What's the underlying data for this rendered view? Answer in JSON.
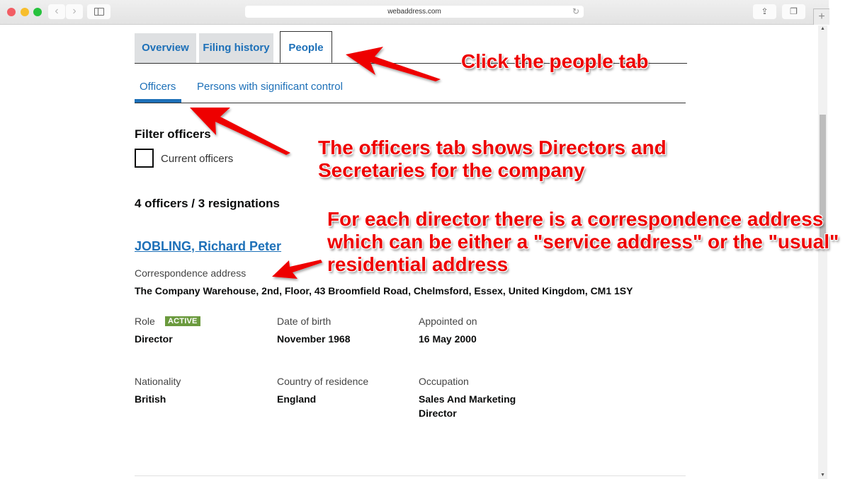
{
  "browser": {
    "url": "webaddress.com",
    "icons": {
      "close": "close-window-icon",
      "minimize": "minimize-window-icon",
      "maximize": "maximize-window-icon",
      "back": "chevron-left-icon",
      "forward": "chevron-right-icon",
      "sidebar": "sidebar-icon",
      "reload": "reload-icon",
      "share": "share-icon",
      "tabs": "tabs-overview-icon",
      "new_tab": "plus-icon"
    },
    "back_glyph": "‹",
    "forward_glyph": "›",
    "reload_glyph": "↻",
    "share_glyph": "⇪",
    "tabs_glyph": "❐",
    "new_tab_glyph": "+",
    "scroll_up_glyph": "▲",
    "scroll_down_glyph": "▼"
  },
  "tabs": {
    "main": [
      {
        "label": "Overview",
        "active": false
      },
      {
        "label": "Filing history",
        "active": false
      },
      {
        "label": "People",
        "active": true
      }
    ],
    "sub": [
      {
        "label": "Officers",
        "active": true
      },
      {
        "label": "Persons with significant control",
        "active": false
      }
    ]
  },
  "filter": {
    "heading": "Filter officers",
    "checkbox_label": "Current officers",
    "checked": false
  },
  "summary": {
    "counts": "4 officers / 3 resignations"
  },
  "officer": {
    "name": "JOBLING, Richard Peter",
    "correspondence_label": "Correspondence address",
    "correspondence_address": "The Company Warehouse, 2nd, Floor, 43 Broomfield Road, Chelmsford, Essex, United Kingdom, CM1 1SY",
    "role_label": "Role",
    "status_badge": "ACTIVE",
    "role": "Director",
    "dob_label": "Date of birth",
    "dob": "November 1968",
    "appointed_label": "Appointed on",
    "appointed": "16 May 2000",
    "nationality_label": "Nationality",
    "nationality": "British",
    "residence_label": "Country of residence",
    "residence": "England",
    "occupation_label": "Occupation",
    "occupation_line1": "Sales And Marketing",
    "occupation_line2": "Director"
  },
  "annotations": {
    "people_tab": "Click the people tab",
    "officers_tab": "The officers tab shows Directors and Secretaries for the company",
    "correspondence": "For each director there is a correspondence address which can be either a \"service address\" or the \"usual\" residential address"
  },
  "colors": {
    "link": "#1d70b8",
    "badge": "#6b9a3e",
    "annotation": "#ee0000",
    "tab_inactive_bg": "#dee0e2"
  }
}
